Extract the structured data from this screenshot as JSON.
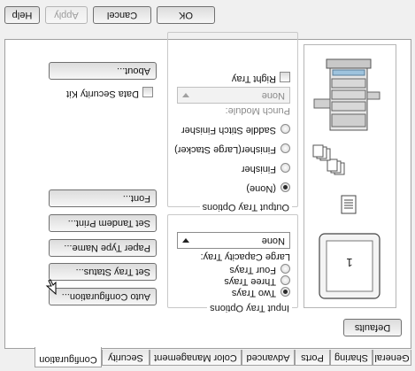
{
  "tabs": [
    {
      "label": "General"
    },
    {
      "label": "Sharing"
    },
    {
      "label": "Ports"
    },
    {
      "label": "Advanced"
    },
    {
      "label": "Color Management"
    },
    {
      "label": "Security"
    },
    {
      "label": "Configuration",
      "active": true
    }
  ],
  "defaults_label": "Defaults",
  "input_tray": {
    "title": "Input Tray Options",
    "options": [
      "Two Trays",
      "Three Trays",
      "Four Trays"
    ],
    "selected": "Two Trays",
    "large_capacity_label": "Large Capacity Tray:",
    "large_capacity_value": "None"
  },
  "output_tray": {
    "title": "Output Tray Options",
    "options": [
      "(None)",
      "Finisher",
      "Finisher(Large Stacker)",
      "Saddle Stitch Finisher"
    ],
    "selected": "(None)",
    "punch_label": "Punch Module:",
    "punch_value": "None",
    "right_tray_label": "Right Tray"
  },
  "side_buttons": {
    "auto_config": "Auto Configuration...",
    "set_tray_status": "Set Tray Status...",
    "paper_type_name": "Paper Type Name...",
    "set_tandem_print": "Set Tandem Print...",
    "font": "Font...",
    "about": "About..."
  },
  "data_security_label": "Data Security Kit",
  "dialog_buttons": {
    "ok": "OK",
    "cancel": "Cancel",
    "apply": "Apply",
    "help": "Help"
  },
  "colors": {
    "accent": "#3c7fb1",
    "panel_bg": "#ffffff",
    "dialog_bg": "#f0f0f0"
  },
  "preview": {
    "paper_mark": "1",
    "tray_icons": [
      "paper-sheet-icon",
      "output-stack-icon",
      "printer-with-trays-icon"
    ]
  }
}
